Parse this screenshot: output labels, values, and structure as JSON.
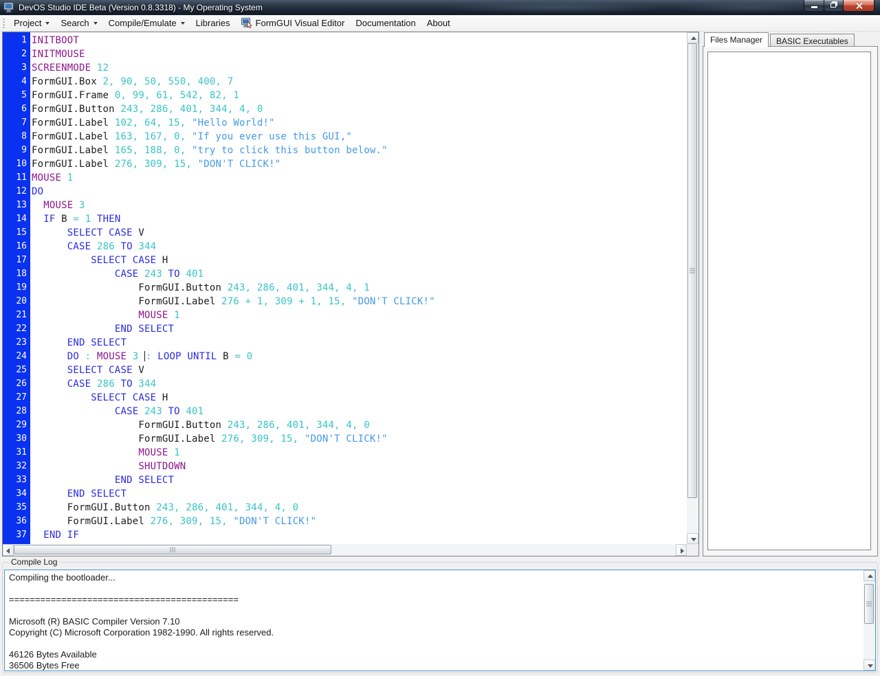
{
  "window": {
    "title": "DevOS Studio IDE Beta (Version 0.8.3318) - My Operating System"
  },
  "menu": {
    "items": [
      {
        "label": "Project",
        "dropdown": true
      },
      {
        "label": "Search",
        "dropdown": true
      },
      {
        "label": "Compile/Emulate",
        "dropdown": true
      },
      {
        "label": "Libraries",
        "dropdown": false
      },
      {
        "label": "FormGUI Visual Editor",
        "dropdown": false,
        "icon": "formgui-editor-icon"
      },
      {
        "label": "Documentation",
        "dropdown": false
      },
      {
        "label": "About",
        "dropdown": false
      }
    ]
  },
  "editor": {
    "caret_line": 24,
    "lines": [
      {
        "n": 1,
        "segs": [
          [
            "sys",
            "INITBOOT"
          ]
        ]
      },
      {
        "n": 2,
        "segs": [
          [
            "sys",
            "INITMOUSE"
          ]
        ]
      },
      {
        "n": 3,
        "segs": [
          [
            "sys",
            "SCREENMODE "
          ],
          [
            "num",
            "12"
          ]
        ]
      },
      {
        "n": 4,
        "segs": [
          [
            "id",
            "FormGUI.Box "
          ],
          [
            "num",
            "2, 90, 50, 550, 400, 7"
          ]
        ]
      },
      {
        "n": 5,
        "segs": [
          [
            "id",
            "FormGUI.Frame "
          ],
          [
            "num",
            "0, 99, 61, 542, 82, 1"
          ]
        ]
      },
      {
        "n": 6,
        "segs": [
          [
            "id",
            "FormGUI.Button "
          ],
          [
            "num",
            "243, 286, 401, 344, 4, 0"
          ]
        ]
      },
      {
        "n": 7,
        "segs": [
          [
            "id",
            "FormGUI.Label "
          ],
          [
            "num",
            "102, 64, 15, "
          ],
          [
            "str",
            "\"Hello World!\""
          ]
        ]
      },
      {
        "n": 8,
        "segs": [
          [
            "id",
            "FormGUI.Label "
          ],
          [
            "num",
            "163, 167, 0, "
          ],
          [
            "str",
            "\"If you ever use this GUI,\""
          ]
        ]
      },
      {
        "n": 9,
        "segs": [
          [
            "id",
            "FormGUI.Label "
          ],
          [
            "num",
            "165, 188, 0, "
          ],
          [
            "str",
            "\"try to click this button below.\""
          ]
        ]
      },
      {
        "n": 10,
        "segs": [
          [
            "id",
            "FormGUI.Label "
          ],
          [
            "num",
            "276, 309, 15, "
          ],
          [
            "str",
            "\"DON'T CLICK!\""
          ]
        ]
      },
      {
        "n": 11,
        "segs": [
          [
            "sys",
            "MOUSE "
          ],
          [
            "num",
            "1"
          ]
        ]
      },
      {
        "n": 12,
        "segs": [
          [
            "kw",
            "DO"
          ]
        ]
      },
      {
        "n": 13,
        "segs": [
          [
            "txt",
            "  "
          ],
          [
            "sys",
            "MOUSE "
          ],
          [
            "num",
            "3"
          ]
        ]
      },
      {
        "n": 14,
        "segs": [
          [
            "txt",
            "  "
          ],
          [
            "kw",
            "IF "
          ],
          [
            "id",
            "B "
          ],
          [
            "op",
            "= "
          ],
          [
            "num",
            "1 "
          ],
          [
            "kw",
            "THEN"
          ]
        ]
      },
      {
        "n": 15,
        "segs": [
          [
            "txt",
            "      "
          ],
          [
            "kw",
            "SELECT CASE "
          ],
          [
            "id",
            "V"
          ]
        ]
      },
      {
        "n": 16,
        "segs": [
          [
            "txt",
            "      "
          ],
          [
            "kw",
            "CASE "
          ],
          [
            "num",
            "286 "
          ],
          [
            "kw",
            "TO "
          ],
          [
            "num",
            "344"
          ]
        ]
      },
      {
        "n": 17,
        "segs": [
          [
            "txt",
            "          "
          ],
          [
            "kw",
            "SELECT CASE "
          ],
          [
            "id",
            "H"
          ]
        ]
      },
      {
        "n": 18,
        "segs": [
          [
            "txt",
            "              "
          ],
          [
            "kw",
            "CASE "
          ],
          [
            "num",
            "243 "
          ],
          [
            "kw",
            "TO "
          ],
          [
            "num",
            "401"
          ]
        ]
      },
      {
        "n": 19,
        "segs": [
          [
            "txt",
            "                  "
          ],
          [
            "id",
            "FormGUI.Button "
          ],
          [
            "num",
            "243, 286, 401, 344, 4, 1"
          ]
        ]
      },
      {
        "n": 20,
        "segs": [
          [
            "txt",
            "                  "
          ],
          [
            "id",
            "FormGUI.Label "
          ],
          [
            "num",
            "276 "
          ],
          [
            "op",
            "+ "
          ],
          [
            "num",
            "1, 309 "
          ],
          [
            "op",
            "+ "
          ],
          [
            "num",
            "1, 15, "
          ],
          [
            "str",
            "\"DON'T CLICK!\""
          ]
        ]
      },
      {
        "n": 21,
        "segs": [
          [
            "txt",
            "                  "
          ],
          [
            "sys",
            "MOUSE "
          ],
          [
            "num",
            "1"
          ]
        ]
      },
      {
        "n": 22,
        "segs": [
          [
            "txt",
            "              "
          ],
          [
            "kw",
            "END SELECT"
          ]
        ]
      },
      {
        "n": 23,
        "segs": [
          [
            "txt",
            "      "
          ],
          [
            "kw",
            "END SELECT"
          ]
        ]
      },
      {
        "n": 24,
        "segs": [
          [
            "txt",
            "      "
          ],
          [
            "kw",
            "DO "
          ],
          [
            "op",
            ": "
          ],
          [
            "sys",
            "MOUSE "
          ],
          [
            "num",
            "3 "
          ],
          [
            "caret",
            ""
          ],
          [
            "op",
            ": "
          ],
          [
            "kw",
            "LOOP UNTIL "
          ],
          [
            "id",
            "B "
          ],
          [
            "op",
            "= "
          ],
          [
            "num",
            "0"
          ]
        ]
      },
      {
        "n": 25,
        "segs": [
          [
            "txt",
            "      "
          ],
          [
            "kw",
            "SELECT CASE "
          ],
          [
            "id",
            "V"
          ]
        ]
      },
      {
        "n": 26,
        "segs": [
          [
            "txt",
            "      "
          ],
          [
            "kw",
            "CASE "
          ],
          [
            "num",
            "286 "
          ],
          [
            "kw",
            "TO "
          ],
          [
            "num",
            "344"
          ]
        ]
      },
      {
        "n": 27,
        "segs": [
          [
            "txt",
            "          "
          ],
          [
            "kw",
            "SELECT CASE "
          ],
          [
            "id",
            "H"
          ]
        ]
      },
      {
        "n": 28,
        "segs": [
          [
            "txt",
            "              "
          ],
          [
            "kw",
            "CASE "
          ],
          [
            "num",
            "243 "
          ],
          [
            "kw",
            "TO "
          ],
          [
            "num",
            "401"
          ]
        ]
      },
      {
        "n": 29,
        "segs": [
          [
            "txt",
            "                  "
          ],
          [
            "id",
            "FormGUI.Button "
          ],
          [
            "num",
            "243, 286, 401, 344, 4, 0"
          ]
        ]
      },
      {
        "n": 30,
        "segs": [
          [
            "txt",
            "                  "
          ],
          [
            "id",
            "FormGUI.Label "
          ],
          [
            "num",
            "276, 309, 15, "
          ],
          [
            "str",
            "\"DON'T CLICK!\""
          ]
        ]
      },
      {
        "n": 31,
        "segs": [
          [
            "txt",
            "                  "
          ],
          [
            "sys",
            "MOUSE "
          ],
          [
            "num",
            "1"
          ]
        ]
      },
      {
        "n": 32,
        "segs": [
          [
            "txt",
            "                  "
          ],
          [
            "sys",
            "SHUTDOWN"
          ]
        ]
      },
      {
        "n": 33,
        "segs": [
          [
            "txt",
            "              "
          ],
          [
            "kw",
            "END SELECT"
          ]
        ]
      },
      {
        "n": 34,
        "segs": [
          [
            "txt",
            "      "
          ],
          [
            "kw",
            "END SELECT"
          ]
        ]
      },
      {
        "n": 35,
        "segs": [
          [
            "txt",
            "      "
          ],
          [
            "id",
            "FormGUI.Button "
          ],
          [
            "num",
            "243, 286, 401, 344, 4, 0"
          ]
        ]
      },
      {
        "n": 36,
        "segs": [
          [
            "txt",
            "      "
          ],
          [
            "id",
            "FormGUI.Label "
          ],
          [
            "num",
            "276, 309, 15, "
          ],
          [
            "str",
            "\"DON'T CLICK!\""
          ]
        ]
      },
      {
        "n": 37,
        "segs": [
          [
            "txt",
            "  "
          ],
          [
            "kw",
            "END IF"
          ]
        ]
      }
    ]
  },
  "side_panel": {
    "tabs": [
      {
        "label": "Files Manager",
        "active": true
      },
      {
        "label": "BASIC Executables",
        "active": false
      }
    ]
  },
  "compile_log": {
    "label": "Compile Log",
    "lines": [
      "Compiling the bootloader...",
      "",
      "============================================",
      "",
      "Microsoft (R) BASIC Compiler Version 7.10",
      "Copyright (C) Microsoft Corporation 1982-1990. All rights reserved.",
      "",
      "46126 Bytes Available",
      "36506 Bytes Free"
    ]
  },
  "colors": {
    "gutter_bg": "#0a31f0",
    "keyword": "#2a2ae4",
    "system_command": "#8d168d",
    "identifier": "#1c1c1c",
    "number": "#38c4c8",
    "operator": "#52bfbf",
    "string": "#4499ea",
    "log_border": "#4f94cd",
    "close_button": "#bb4530"
  }
}
